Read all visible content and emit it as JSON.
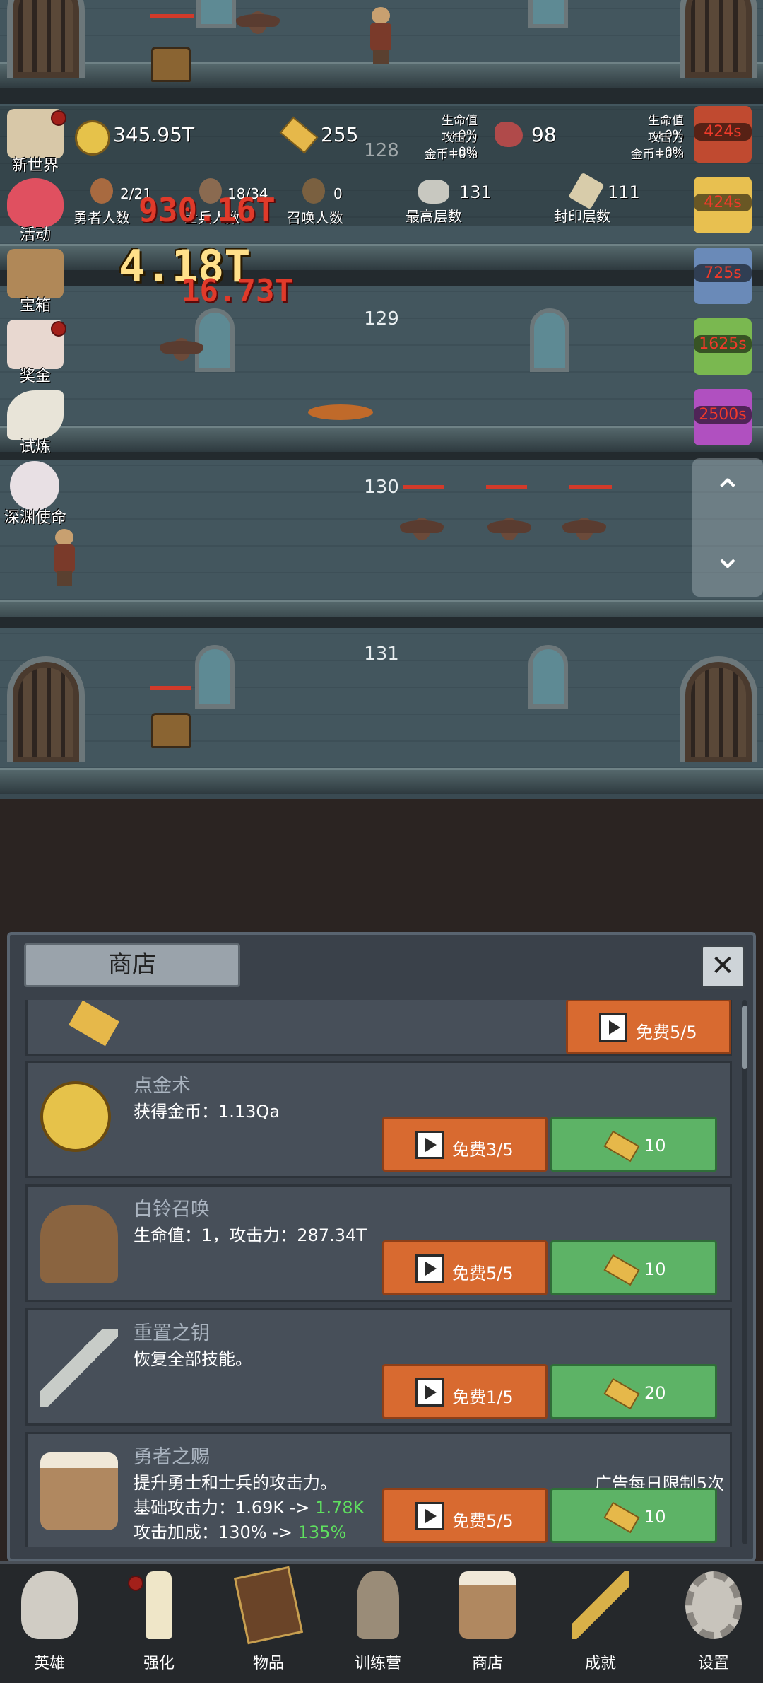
{
  "floors": [
    {
      "num": "128"
    },
    {
      "num": "129"
    },
    {
      "num": "130"
    },
    {
      "num": "131"
    }
  ],
  "resources": {
    "gold": "345.95T",
    "gold_bars": "255",
    "meat": "98",
    "buffs_left": {
      "hp": "生命值+0%",
      "atk": "攻击力+0%",
      "coin": "金币+0%"
    },
    "buffs_right": {
      "hp": "生命值+0%",
      "atk": "攻击力+0%",
      "coin": "金币+0%"
    }
  },
  "stats": {
    "heroes": {
      "value": "2/21",
      "label": "勇者人数"
    },
    "soldiers": {
      "value": "18/34",
      "label": "士兵人数"
    },
    "summons": {
      "value": "0",
      "label": "召唤人数"
    },
    "max_floor": {
      "value": "131",
      "label": "最高层数"
    },
    "seal_floor": {
      "value": "111",
      "label": "封印层数"
    }
  },
  "damage_texts": [
    "930.16T",
    "4.18T",
    "16.73T"
  ],
  "side_menu": [
    {
      "label": "新世界",
      "icon": "map-scroll-icon"
    },
    {
      "label": "活动",
      "icon": "heart-icon"
    },
    {
      "label": "宝箱",
      "icon": "treasure-chest-icon"
    },
    {
      "label": "奖金",
      "icon": "envelope-icon"
    },
    {
      "label": "试炼",
      "icon": "feather-icon"
    },
    {
      "label": "深渊使命",
      "icon": "crystal-ball-icon"
    }
  ],
  "timers": [
    "424s",
    "424s",
    "725s",
    "1625s",
    "2500s"
  ],
  "shop": {
    "title": "商店",
    "close": "✕",
    "top_item_free": "免费5/5",
    "items": [
      {
        "name": "点金术",
        "desc_lines": [
          "获得金币：1.13Qa"
        ],
        "ad_label": "免费3/5",
        "price": "10"
      },
      {
        "name": "白铃召唤",
        "desc_lines": [
          "生命值：1，攻击力：287.34T"
        ],
        "ad_label": "免费5/5",
        "price": "10"
      },
      {
        "name": "重置之钥",
        "desc_lines": [
          "恢复全部技能。"
        ],
        "ad_label": "免费1/5",
        "price": "20"
      },
      {
        "name": "勇者之赐",
        "desc_line1": "提升勇士和士兵的攻击力。",
        "desc_line2_a": "基础攻击力：1.69K -> ",
        "desc_line2_b": "1.78K",
        "desc_line3_a": "攻击加成：130% -> ",
        "desc_line3_b": "135%",
        "note": "广告每日限制5次",
        "ad_label": "免费5/5",
        "price": "10"
      }
    ]
  },
  "nav": [
    {
      "label": "英雄",
      "icon": "skull-icon"
    },
    {
      "label": "强化",
      "icon": "candle-icon"
    },
    {
      "label": "物品",
      "icon": "book-icon"
    },
    {
      "label": "训练营",
      "icon": "lantern-icon"
    },
    {
      "label": "商店",
      "icon": "beer-mug-icon"
    },
    {
      "label": "成就",
      "icon": "key-icon"
    },
    {
      "label": "设置",
      "icon": "gear-icon"
    }
  ],
  "scroll": {
    "up": "⌃",
    "down": "⌄"
  },
  "colors": {
    "ad_button": "#d86a30",
    "gold_button": "#5db366",
    "damage_red": "#d23a2a",
    "buff_green": "#5fe05f"
  }
}
